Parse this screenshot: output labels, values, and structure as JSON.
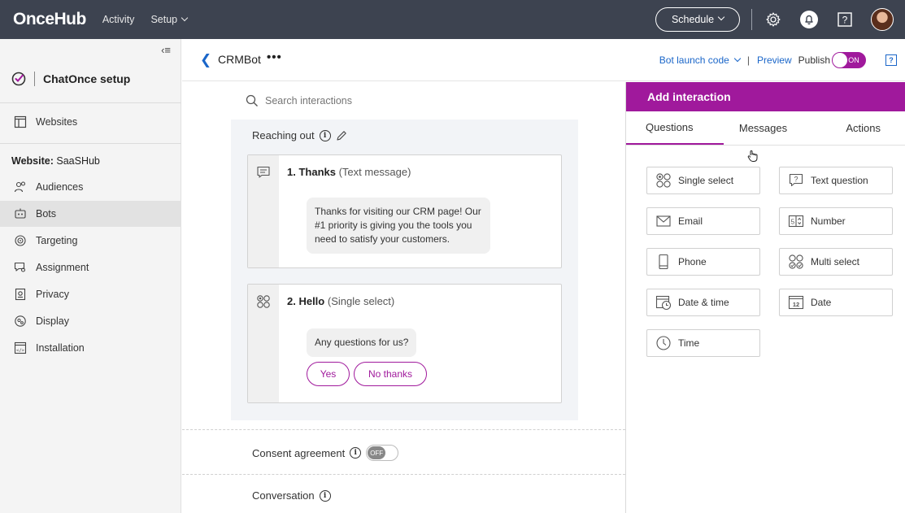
{
  "topbar": {
    "logo": "OnceHub",
    "nav": [
      {
        "label": "Activity"
      },
      {
        "label": "Setup"
      }
    ],
    "schedule_label": "Schedule",
    "icons": [
      "gear-icon",
      "bell-icon",
      "help-icon",
      "avatar"
    ]
  },
  "sidebar": {
    "title": "ChatOnce setup",
    "websites_label": "Websites",
    "website_prefix": "Website:",
    "website_name": "SaaSHub",
    "items": [
      {
        "label": "Audiences",
        "icon": "audiences-icon"
      },
      {
        "label": "Bots",
        "icon": "bot-icon",
        "active": true
      },
      {
        "label": "Targeting",
        "icon": "targeting-icon"
      },
      {
        "label": "Assignment",
        "icon": "assignment-icon"
      },
      {
        "label": "Privacy",
        "icon": "privacy-icon"
      },
      {
        "label": "Display",
        "icon": "display-icon"
      },
      {
        "label": "Installation",
        "icon": "installation-icon"
      }
    ]
  },
  "header": {
    "bot_name": "CRMBot",
    "more": "•••",
    "launch_code": "Bot launch code",
    "separator": "|",
    "preview": "Preview",
    "publish": "Publish",
    "publish_state": "ON"
  },
  "canvas": {
    "search_placeholder": "Search interactions",
    "flow_title": "Reaching out",
    "cards": [
      {
        "title": "1. Thanks",
        "type": "(Text message)",
        "message": "Thanks for visiting our CRM page! Our #1 priority is giving you the tools you need to satisfy your customers."
      },
      {
        "title": "2. Hello",
        "type": "(Single select)",
        "message": "Any questions for us?",
        "options": [
          "Yes",
          "No thanks"
        ]
      }
    ],
    "consent_label": "Consent agreement",
    "consent_state": "OFF",
    "conversation_label": "Conversation"
  },
  "panel": {
    "title": "Add interaction",
    "tabs": [
      "Questions",
      "Messages",
      "Actions"
    ],
    "interactions": [
      {
        "label": "Single select",
        "icon": "single-select-icon"
      },
      {
        "label": "Text question",
        "icon": "text-question-icon"
      },
      {
        "label": "Email",
        "icon": "email-icon"
      },
      {
        "label": "Number",
        "icon": "number-icon"
      },
      {
        "label": "Phone",
        "icon": "phone-icon"
      },
      {
        "label": "Multi select",
        "icon": "multi-select-icon"
      },
      {
        "label": "Date & time",
        "icon": "date-time-icon"
      },
      {
        "label": "Date",
        "icon": "date-icon"
      },
      {
        "label": "Time",
        "icon": "clock-icon"
      }
    ]
  },
  "colors": {
    "topbar": "#3d4350",
    "accent": "#a0199c",
    "link": "#1a66c9"
  }
}
